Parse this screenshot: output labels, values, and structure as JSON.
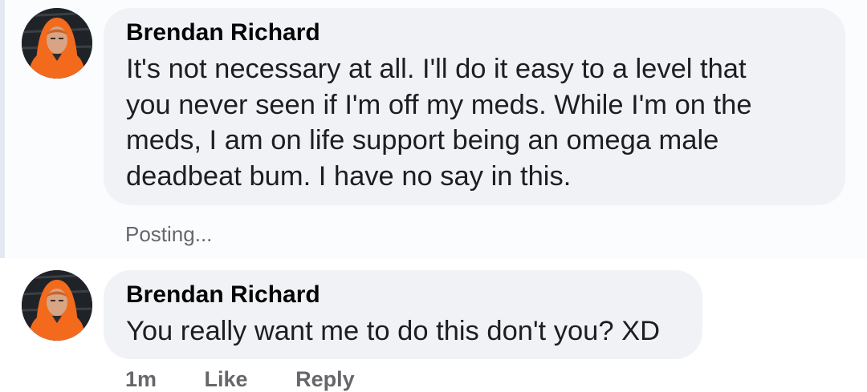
{
  "comments": [
    {
      "author": "Brendan Richard",
      "text": "It's not necessary at all. I'll do it easy to a level that\nyou never seen if I'm off my meds. While I'm on the\nmeds, I am on life support being an omega male\ndeadbeat bum. I have no say in this.",
      "status": "Posting..."
    },
    {
      "author": "Brendan Richard",
      "text": "You really want me to do this don't you? XD",
      "actions": {
        "time": "1m",
        "like": "Like",
        "reply": "Reply"
      }
    }
  ],
  "colors": {
    "bubble": "#f0f2f5",
    "pending_background": "#fbfcfe",
    "pending_bar": "#e3e8f3",
    "secondary_text": "#65676b"
  }
}
